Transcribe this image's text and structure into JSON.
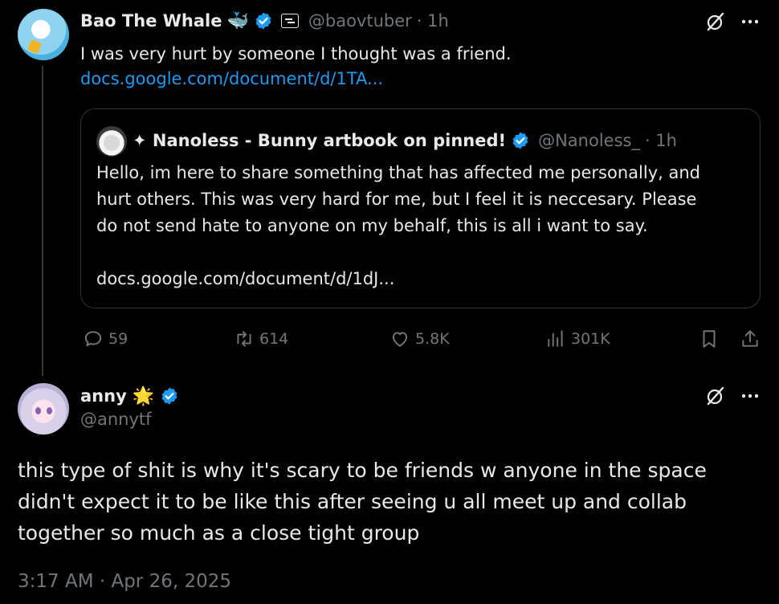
{
  "tweet": {
    "author_name": "Bao The Whale",
    "author_emoji": "🐳",
    "handle": "@baovtuber",
    "time": "· 1h",
    "text": "I was very hurt by someone I thought was a friend.",
    "link": "docs.google.com/document/d/1TA...",
    "stats": {
      "replies": "59",
      "reposts": "614",
      "likes": "5.8K",
      "views": "301K"
    }
  },
  "quoted": {
    "author_name": "✦ Nanoless - Bunny artbook on pinned!",
    "handle": "@Nanoless_",
    "time": "· 1h",
    "text_line1": "Hello, im here to share something that has affected me personally, and",
    "text_line2": "hurt others. This was very hard for me, but I feel it is neccesary. Please",
    "text_line3": "do not send hate to anyone on my behalf, this is all i want to say.",
    "link": "docs.google.com/document/d/1dJ..."
  },
  "reply": {
    "author_name": "anny",
    "author_emoji": "🌟",
    "handle": "@annytf",
    "text_line1": "this type of shit is why it's scary to be friends w anyone in the space",
    "text_line2": "didn't expect it to be like this after seeing u all meet up and collab",
    "text_line3": "together so much as a close tight group",
    "timestamp": "3:17 AM · Apr 26, 2025"
  },
  "colors": {
    "background": "#000000",
    "text": "#e7e9ea",
    "muted": "#71767b",
    "link": "#1d9bf0",
    "verified": "#1d9bf0",
    "border": "#2f3336"
  },
  "icons": {
    "reply": "speech-bubble-icon",
    "repost": "repost-icon",
    "like": "heart-icon",
    "views": "bar-chart-icon",
    "bookmark": "bookmark-icon",
    "share": "share-icon",
    "grok": "grok-icon",
    "more": "more-icon"
  }
}
